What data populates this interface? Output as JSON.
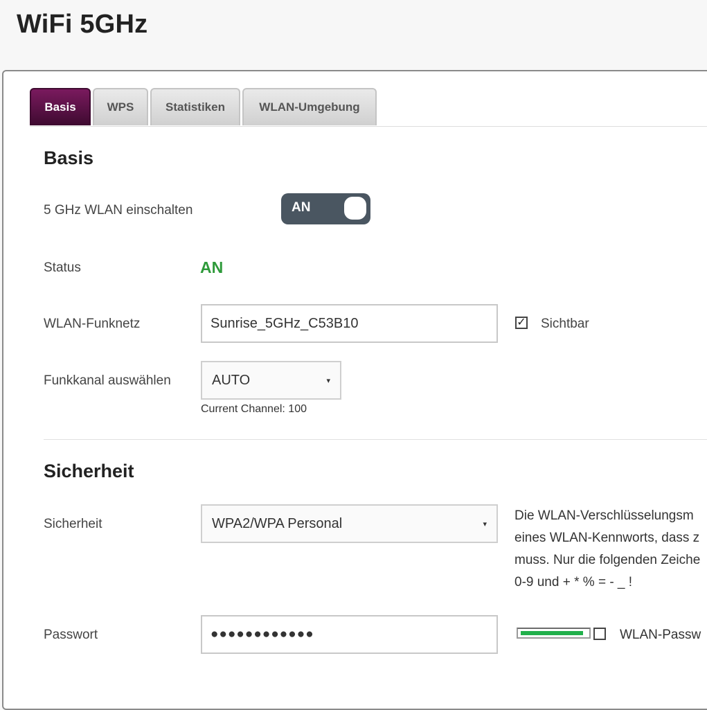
{
  "page": {
    "title": "WiFi 5GHz"
  },
  "tabs": [
    {
      "label": "Basis",
      "active": true
    },
    {
      "label": "WPS",
      "active": false
    },
    {
      "label": "Statistiken",
      "active": false
    },
    {
      "label": "WLAN-Umgebung",
      "active": false
    }
  ],
  "basis": {
    "heading": "Basis",
    "enable_label": "5 GHz WLAN einschalten",
    "toggle_state": "AN",
    "status_label": "Status",
    "status_value": "AN",
    "ssid_label": "WLAN-Funknetz",
    "ssid_value": "Sunrise_5GHz_C53B10",
    "visible_checked": true,
    "visible_check_glyph": "✓",
    "visible_label": "Sichtbar",
    "channel_label": "Funkkanal auswählen",
    "channel_value": "AUTO",
    "channel_hint": "Current Channel: 100"
  },
  "security": {
    "heading": "Sicherheit",
    "mode_label": "Sicherheit",
    "mode_value": "WPA2/WPA Personal",
    "info_lines": [
      "Die WLAN-Verschlüsselungsm",
      "eines WLAN-Kennworts, dass z",
      "muss. Nur die folgenden Zeiche",
      "0-9 und + * % = - _ !"
    ],
    "password_label": "Passwort",
    "password_value": "●●●●●●●●●●●●",
    "strength_level": 0.95,
    "show_password_checked": false,
    "show_password_label": "WLAN-Passw"
  },
  "colors": {
    "active_tab": "#5c1247",
    "status_on": "#2e9a3a",
    "toggle_bg": "#4a5661",
    "strength_fill": "#21b04b"
  },
  "icons": {
    "select_caret": "▾"
  }
}
